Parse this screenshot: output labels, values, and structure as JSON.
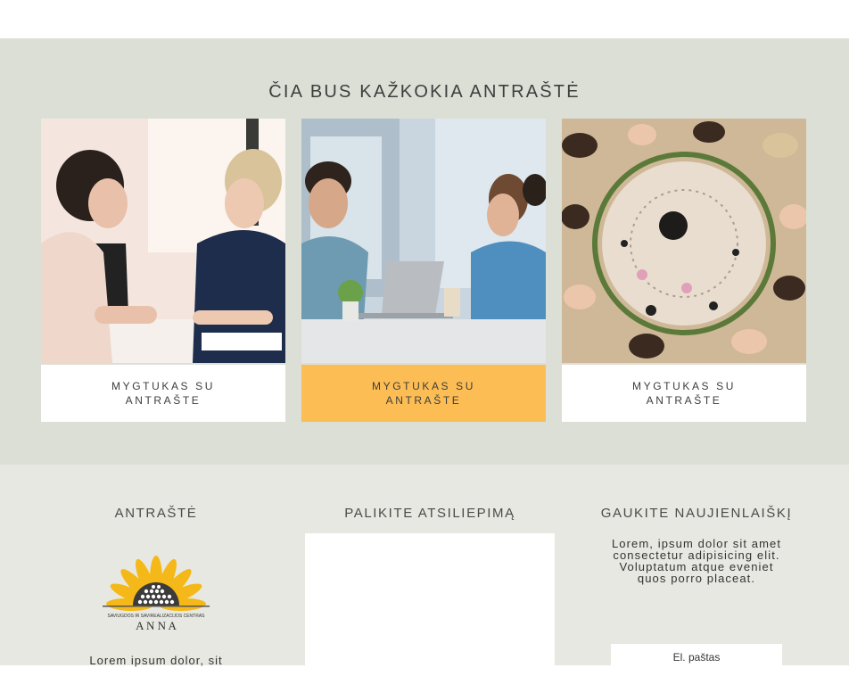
{
  "services": {
    "title": "ČIA BUS KAŽKOKIA ANTRAŠTĖ",
    "cards": [
      {
        "button_label": "MYGTUKAS SU ANTRAŠTE",
        "image": "two women in business meeting photo"
      },
      {
        "button_label": "MYGTUKAS SU ANTRAŠTE",
        "image": "colleagues talking at office table photo"
      },
      {
        "button_label": "MYGTUKAS SU ANTRAŠTE",
        "image": "women lying in circle around mandala photo"
      }
    ],
    "active_button_color": "#fdbd55"
  },
  "footer": {
    "col1": {
      "title": "ANTRAŠTĖ",
      "logo_text_small": "SAVIUGDOS IR SAVIREALIZACIJOS CENTRAS",
      "logo_text_big": "A N N A",
      "text": "Lorem ipsum dolor, sit"
    },
    "col2": {
      "title": "PALIKITE ATSILIEPIMĄ"
    },
    "col3": {
      "title": "GAUKITE NAUJIENLAIŠKĮ",
      "text": "Lorem, ipsum dolor sit amet consectetur adipisicing elit. Voluptatum atque eveniet quos porro placeat.",
      "email_placeholder": "El. paštas"
    }
  }
}
